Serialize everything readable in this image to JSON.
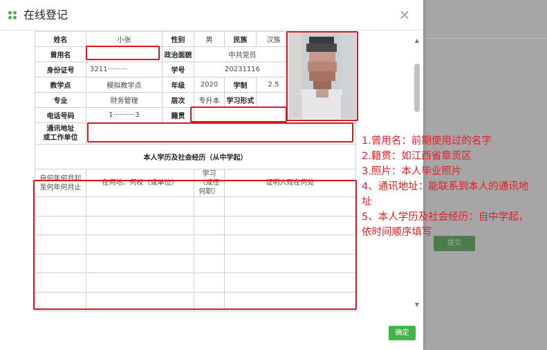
{
  "dialog": {
    "title": "在线登记",
    "ok_label": "确定"
  },
  "background": {
    "submit_label": "提交"
  },
  "form": {
    "row1": {
      "name_label": "姓名",
      "name_value": "小张",
      "gender_label": "性别",
      "gender_value": "男",
      "ethnicity_label": "民族",
      "ethnicity_value": "汉族"
    },
    "row2": {
      "former_name_label": "曾用名",
      "former_name_value": "",
      "political_label": "政治面貌",
      "political_value": "中共党员"
    },
    "row3": {
      "id_label": "身份证号",
      "id_value": "3211·········",
      "student_no_label": "学号",
      "student_no_value": "20231116"
    },
    "row4": {
      "center_label": "教学点",
      "center_value": "模拟教学点",
      "grade_label": "年级",
      "grade_value": "2020",
      "system_label": "学制",
      "system_value": "2.5"
    },
    "row5": {
      "major_label": "专业",
      "major_value": "财务管理",
      "level_label": "层次",
      "level_value": "专升本",
      "mode_label": "学习形式",
      "mode_value": ""
    },
    "row6": {
      "phone_label": "电话号码",
      "phone_value": "1··········3",
      "native_label": "籍贯",
      "native_value": ""
    },
    "row7": {
      "address_label_1": "通讯地址",
      "address_label_2": "或工作单位",
      "address_value": ""
    },
    "section_title": "本人学历及社会经历（从中学起）",
    "history_headers": {
      "period": "自何年何月起至何年何月止",
      "place": "在何地、何校（或单位）",
      "role": "学习（或任何职）",
      "witness": "证明人现在何处"
    }
  },
  "notes": [
    "1.曾用名：前期使用过的名字",
    "2.籍贯：如江西省章贡区",
    "3.照片：本人毕业照片",
    "4、通讯地址：能联系到本人的通讯地址",
    "5、本人学历及社会经历：自中学起，依时间顺序填写"
  ],
  "colors": {
    "accent": "#3fb54b",
    "highlight": "#e0121b",
    "note_text": "#e81b23"
  },
  "icons": {
    "title_icon": "four-dots-icon",
    "close": "close-icon"
  }
}
